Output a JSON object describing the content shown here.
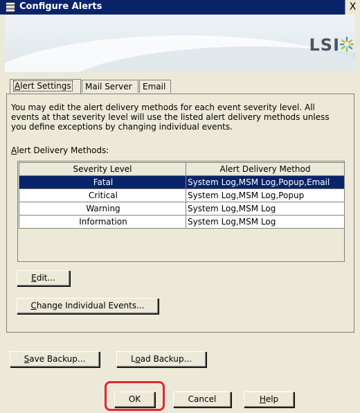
{
  "window": {
    "title": "Configure Alerts",
    "close_glyph": "X"
  },
  "banner": {
    "logo_text": "LSI",
    "logo_icon": "lsi-star-icon"
  },
  "tabs": [
    {
      "label": "Alert Settings",
      "accel": "A",
      "active": true
    },
    {
      "label": "Mail Server",
      "active": false
    },
    {
      "label": "Email",
      "active": false
    }
  ],
  "description": "You may edit the alert delivery methods for each event severity level. All events at that severity level will use the listed alert delivery methods unless you define exceptions by changing individual events.",
  "methods_label": {
    "accel": "A",
    "rest": "lert Delivery Methods:"
  },
  "grid": {
    "headers": [
      "Severity Level",
      "Alert Delivery Method"
    ],
    "rows": [
      {
        "severity": "Fatal",
        "method": "System Log,MSM Log,Popup,Email",
        "selected": true
      },
      {
        "severity": "Critical",
        "method": "System Log,MSM Log,Popup",
        "selected": false
      },
      {
        "severity": "Warning",
        "method": "System Log,MSM Log",
        "selected": false
      },
      {
        "severity": "Information",
        "method": "System Log,MSM Log",
        "selected": false
      }
    ]
  },
  "buttons": {
    "edit": {
      "accel": "E",
      "rest": "dit..."
    },
    "change_events": {
      "accel": "C",
      "rest": "hange Individual Events..."
    },
    "save_backup": {
      "accel": "S",
      "rest": "ave Backup..."
    },
    "load_backup": {
      "pre": "L",
      "accel": "o",
      "rest": "ad Backup..."
    },
    "ok": "OK",
    "cancel": "Cancel",
    "help": {
      "accel": "H",
      "rest": "elp"
    }
  },
  "colors": {
    "title_bar": "#0a246a",
    "selection": "#0a246a",
    "highlight_border": "#e5262e",
    "dialog_bg": "#ece9d8"
  }
}
